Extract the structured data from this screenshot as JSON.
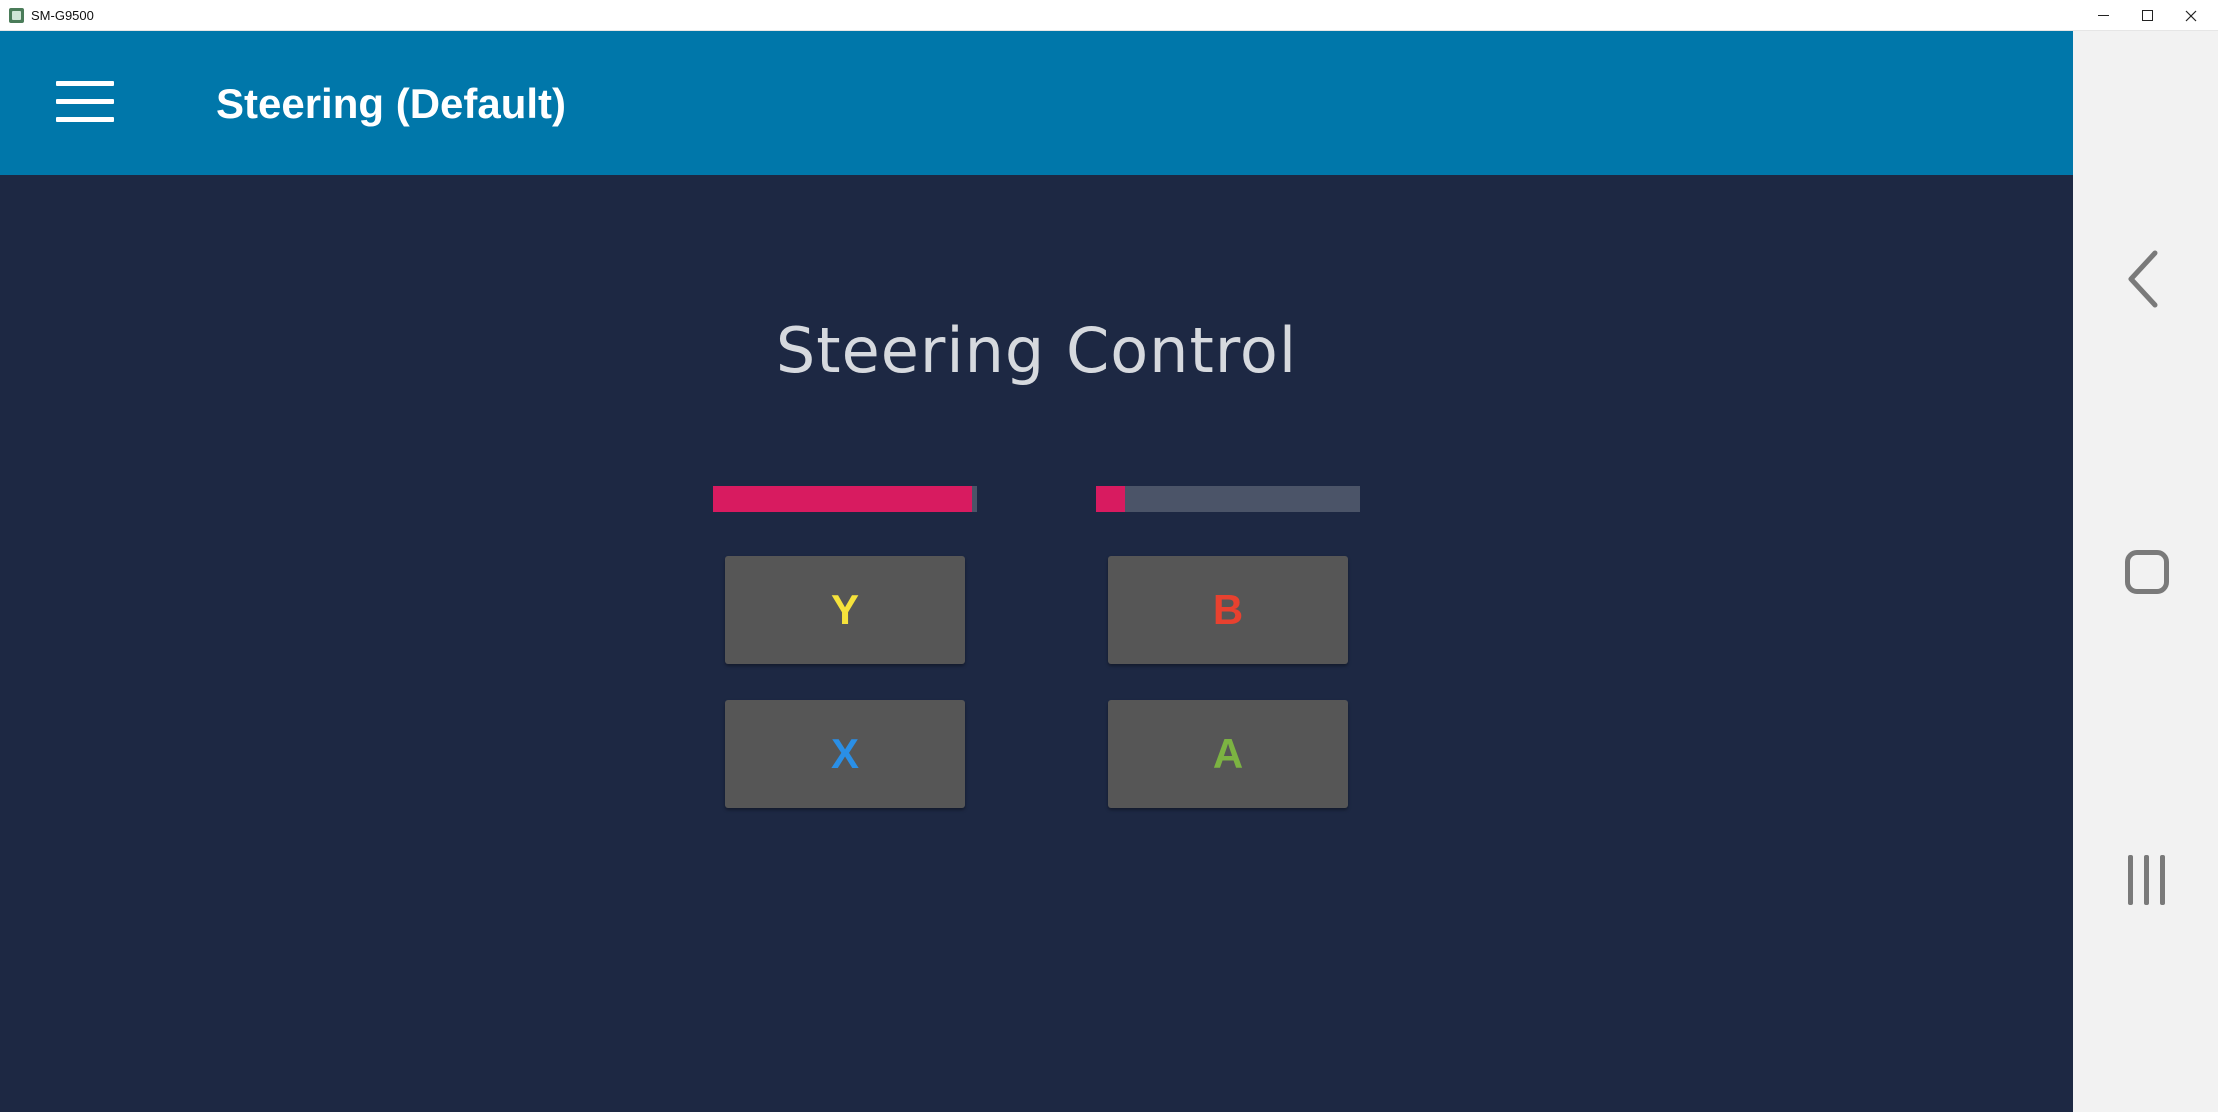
{
  "window": {
    "title": "SM-G9500",
    "controls": [
      "minimize",
      "maximize",
      "close"
    ]
  },
  "appbar": {
    "menu_icon": "hamburger-menu-icon",
    "title": "Steering (Default)"
  },
  "main": {
    "heading": "Steering Control",
    "meters": [
      {
        "name": "left",
        "level": 0.98
      },
      {
        "name": "right",
        "level": 0.11
      }
    ],
    "buttons": {
      "y": {
        "label": "Y",
        "color": "#f5e23b"
      },
      "b": {
        "label": "B",
        "color": "#e8412f"
      },
      "x": {
        "label": "X",
        "color": "#2a8fe6"
      },
      "a": {
        "label": "A",
        "color": "#7cb342"
      }
    }
  },
  "colors": {
    "appbar": "#0077aa",
    "background": "#1d2843",
    "meter_fill": "#d81b60",
    "meter_track": "#4b5468",
    "button_bg": "#565656"
  },
  "navbar": {
    "back_icon": "back-chevron-icon",
    "home_icon": "home-square-icon",
    "recents_icon": "recents-bars-icon"
  }
}
